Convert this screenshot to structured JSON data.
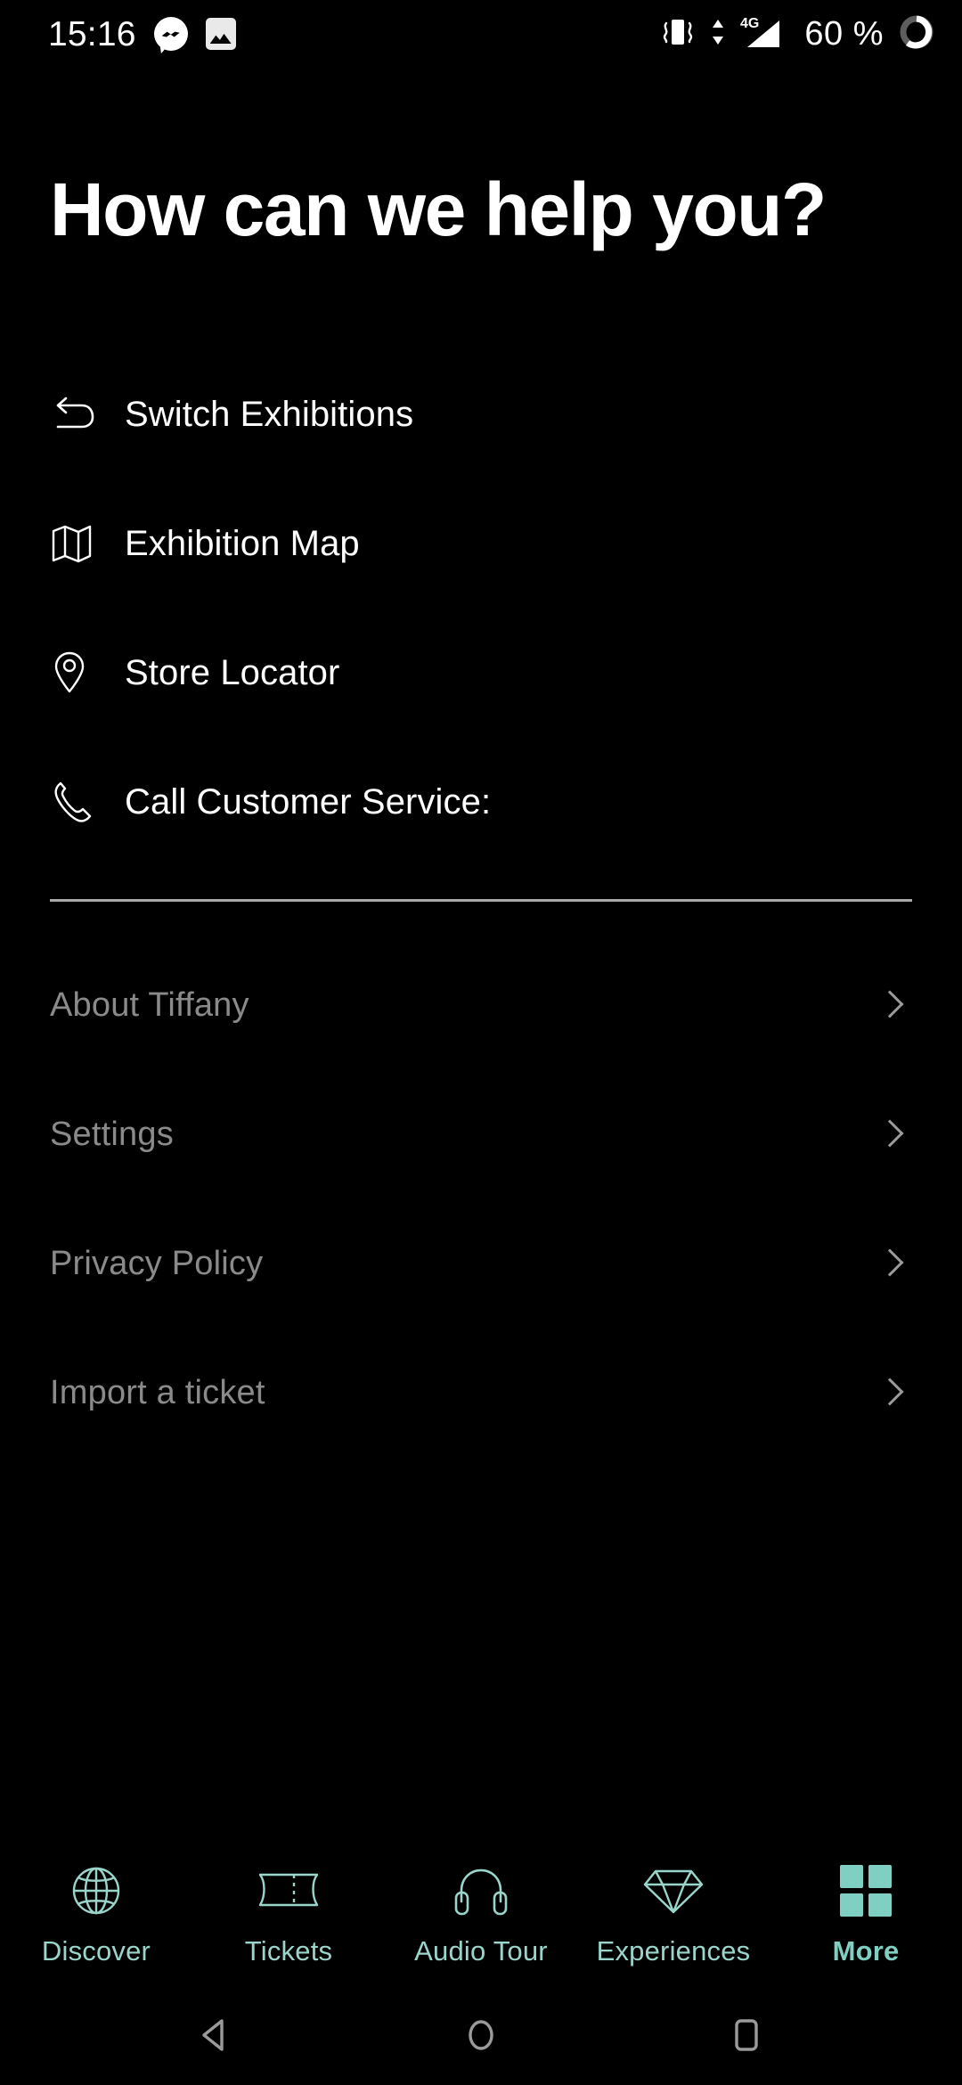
{
  "status_bar": {
    "clock": "15:16",
    "battery_text": "60 %",
    "icons": [
      "messenger-icon",
      "photo-icon",
      "vibrate-icon",
      "4g-signal-icon",
      "battery-circle-icon"
    ],
    "network_label": "4G"
  },
  "header": {
    "title": "How can we help you?"
  },
  "primary_menu": {
    "items": [
      {
        "label": "Switch Exhibitions",
        "icon": "return-arrow-icon"
      },
      {
        "label": "Exhibition Map",
        "icon": "folded-map-icon"
      },
      {
        "label": "Store Locator",
        "icon": "map-pin-icon"
      },
      {
        "label": "Call Customer Service:",
        "icon": "phone-icon"
      }
    ]
  },
  "secondary_menu": {
    "items": [
      {
        "label": "About Tiffany"
      },
      {
        "label": "Settings"
      },
      {
        "label": "Privacy Policy"
      },
      {
        "label": "Import a ticket"
      }
    ]
  },
  "tabbar": {
    "active_index": 4,
    "tabs": [
      {
        "label": "Discover",
        "icon": "globe-icon"
      },
      {
        "label": "Tickets",
        "icon": "ticket-icon"
      },
      {
        "label": "Audio Tour",
        "icon": "headphones-icon"
      },
      {
        "label": "Experiences",
        "icon": "diamond-icon"
      },
      {
        "label": "More",
        "icon": "grid-squares-icon"
      }
    ]
  },
  "navbar": {
    "buttons": [
      {
        "name": "back-button",
        "icon": "triangle-back-icon"
      },
      {
        "name": "home-button",
        "icon": "circle-home-icon"
      },
      {
        "name": "recents-button",
        "icon": "square-recents-icon"
      }
    ]
  },
  "colors": {
    "background": "#000000",
    "primary_text": "#ffffff",
    "secondary_text": "#8a8a8a",
    "accent_teal": "#7fd0c2",
    "inactive_teal": "#9ad5cb",
    "divider": "#a8a8a8",
    "nav_gray": "#9a9a9a"
  }
}
